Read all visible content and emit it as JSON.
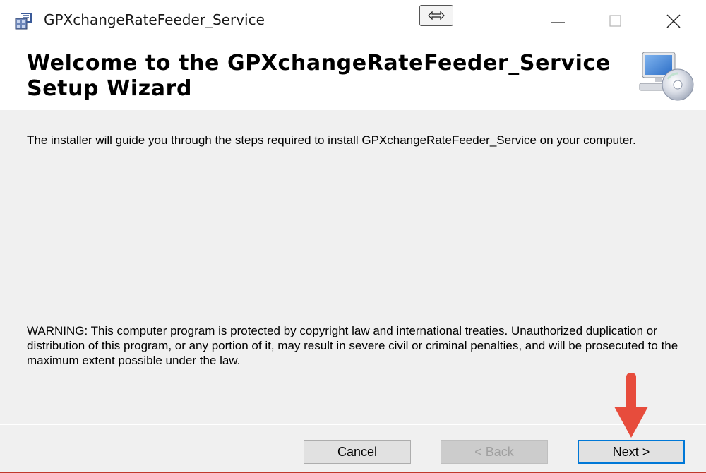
{
  "window": {
    "title": "GPXchangeRateFeeder_Service",
    "controls": {
      "restore": "⇔",
      "minimize": "—",
      "maximize": "□",
      "close": "✕"
    }
  },
  "header": {
    "title_line1": "Welcome to the GPXchangeRateFeeder_Service",
    "title_line2": "Setup Wizard"
  },
  "body": {
    "intro": "The installer will guide you through the steps required to install GPXchangeRateFeeder_Service on your computer.",
    "warning": "WARNING: This computer program is protected by copyright law and international treaties. Unauthorized duplication or distribution of this program, or any portion of it, may result in severe civil or criminal penalties, and will be prosecuted to the maximum extent possible under the law."
  },
  "footer": {
    "cancel_label": "Cancel",
    "back_label": "< Back",
    "next_label": "Next >"
  },
  "colors": {
    "annotation_arrow": "#e74c3c",
    "focus_border": "#0078d7",
    "panel_bg": "#f0f0f0"
  },
  "icons": {
    "app": "installer-box-icon",
    "setup": "computer-cd-icon",
    "annotation": "red-down-arrow"
  }
}
